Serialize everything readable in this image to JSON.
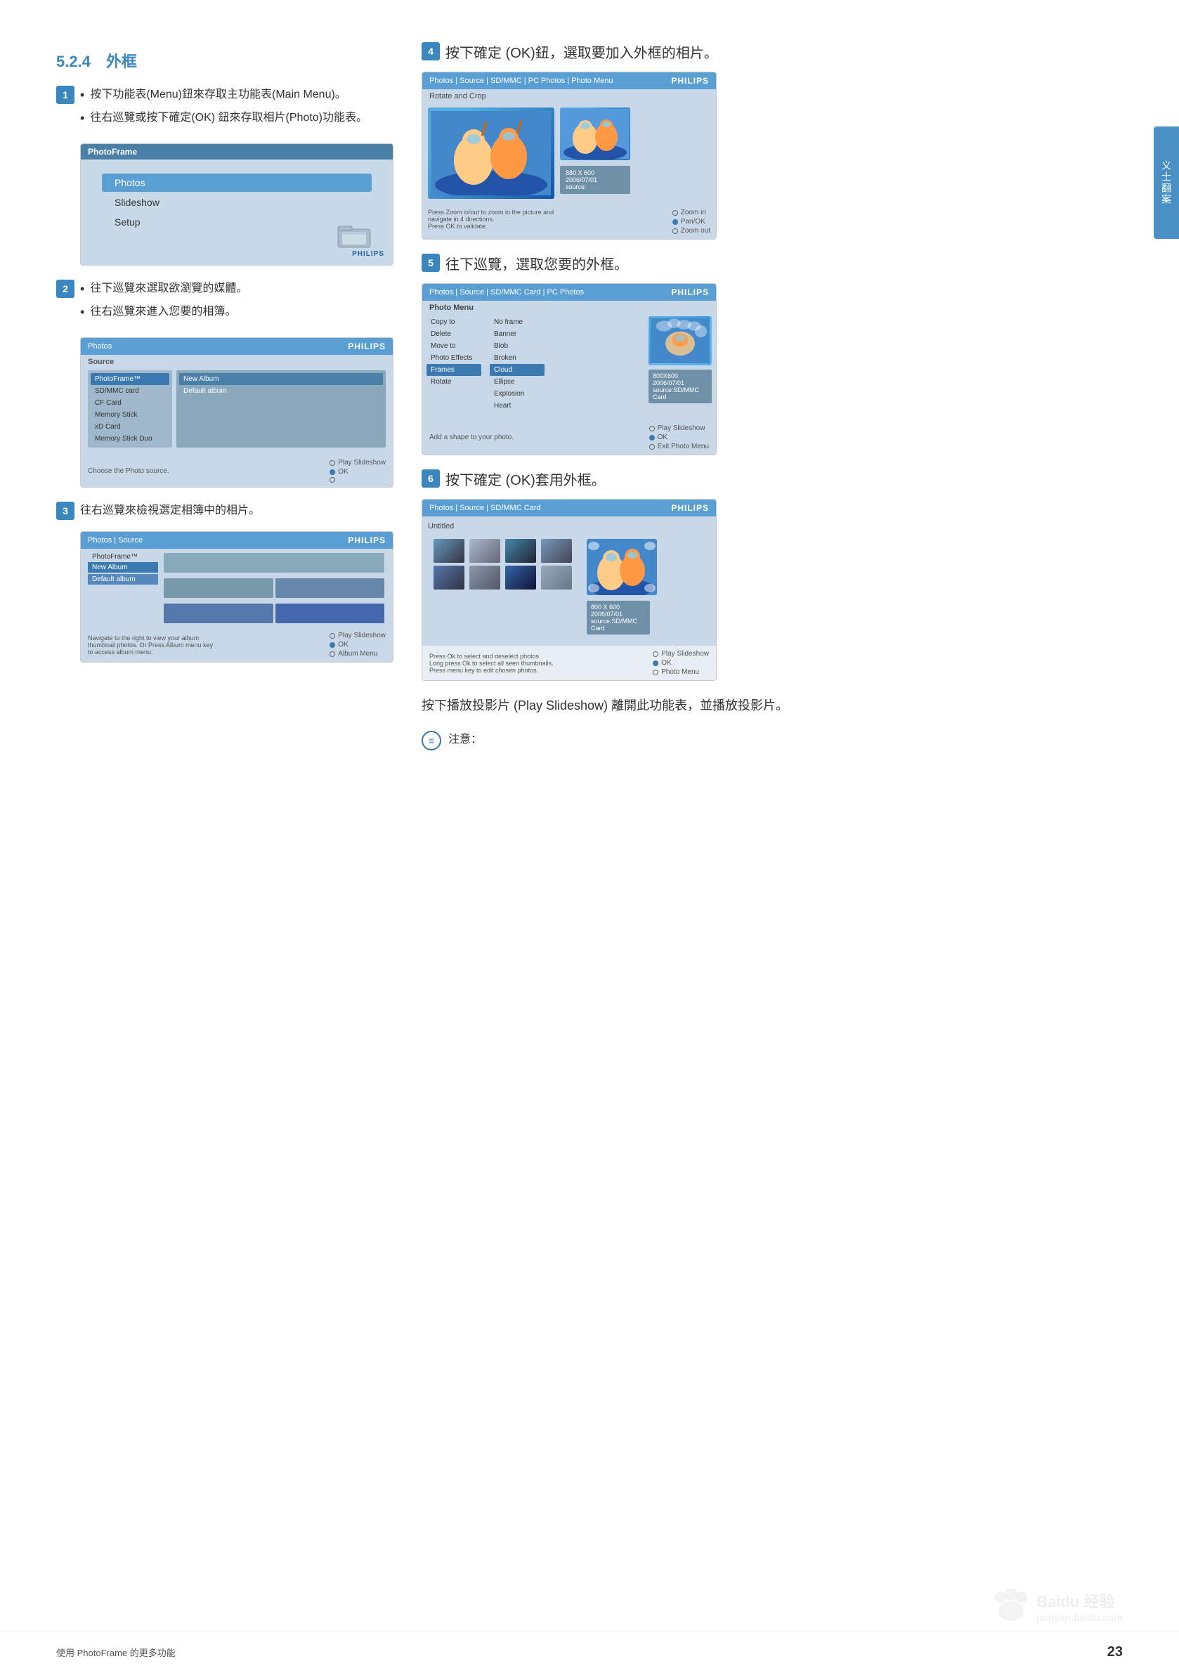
{
  "page": {
    "title": "使用 PhotoFrame 的更多功能",
    "page_number": "23",
    "section": "5.2.4　外框",
    "sidebar_tab": "义士翻案"
  },
  "steps": {
    "step1": {
      "badge": "1",
      "bullets": [
        "按下功能表(Menu)鈕來存取主功能表(Main Menu)。",
        "往右巡覽或按下確定(OK) 鈕來存取相片(Photo)功能表。"
      ]
    },
    "step2": {
      "badge": "2",
      "bullets": [
        "往下巡覽來選取欲瀏覽的媒體。",
        "往右巡覽來進入您要的相簿。"
      ]
    },
    "step3": {
      "badge": "3",
      "text": "往右巡覽來檢視選定相簿中的相片。"
    },
    "step4": {
      "badge": "4",
      "text": "按下確定 (OK)鈕，選取要加入外框的相片。"
    },
    "step5": {
      "badge": "5",
      "text": "往下巡覽，選取您要的外框。"
    },
    "step6": {
      "badge": "6",
      "text": "按下確定 (OK)套用外框。"
    }
  },
  "note": {
    "icon": "≡",
    "text": "注意："
  },
  "slideshow_text": "按下播放投影片 (Play Slideshow) 離開此功能表，並播放投影片。",
  "screens": {
    "photoframe_menu": {
      "title": "PhotoFrame",
      "items": [
        "Photos",
        "Slideshow",
        "Setup"
      ],
      "active_item": "Photos",
      "philips": "PHILIPS"
    },
    "source_screen": {
      "header_path": "Photos",
      "philips": "PHILIPS",
      "source_label": "Source",
      "items": [
        "PhotoFrame™",
        "SD/MMC card",
        "CF Card",
        "Memory Stick",
        "xD Card",
        "Memory Stick Duo"
      ],
      "active_item": "PhotoFrame™",
      "albums": [
        "New Album",
        "Default album"
      ],
      "footer_text": "Choose the Photo source.",
      "options": [
        "Play Slideshow",
        "OK"
      ]
    },
    "album_screen": {
      "header_path": "Photos | Source",
      "philips": "PHILIPS",
      "items": [
        "PhotoFrame™",
        "New Album",
        "Default album"
      ],
      "footer_text": "Navigate to the right to view your album thumbnail photos. Or Press Album menu key to access album menu.",
      "options": [
        "Play Slideshow",
        "OK",
        "Album Menu"
      ]
    },
    "rotate_crop_screen": {
      "header_path": "Photos | Source | SD/MMC | PC Photos | Photo Menu",
      "philips": "PHILIPS",
      "title": "Rotate and Crop",
      "info": "880 X 600\n2006/07/01\nsource:",
      "footer_text": "Press Zoom in/out to zoom in the picture and navigate in 4 directions.\nPress OK to validate.",
      "options": [
        "Zoom in",
        "Pan/OK",
        "Zoom out"
      ]
    },
    "photo_menu_screen": {
      "header_path": "Photos | Source | SD/MMC Card | PC Photos",
      "philips": "PHILIPS",
      "menu_label": "Photo Menu",
      "left_items": [
        "Copy to",
        "Delete",
        "Move to",
        "Photo Effects",
        "Frames",
        "Rotate"
      ],
      "active_left": "Frames",
      "center_items": [
        "No frame",
        "Banner",
        "Blob",
        "Broken",
        "Cloud",
        "Ellipse",
        "Explosion",
        "Heart"
      ],
      "active_center": "Cloud",
      "info": "800X600\n2006/07/01\nsource:SD/MMC Card",
      "footer_text": "Add a shape to your photo.",
      "options": [
        "Play Slideshow",
        "OK",
        "Exit Photo Menu"
      ]
    },
    "photo_grid_screen": {
      "header_path": "Photos | Source | SD/MMC Card",
      "philips": "PHILIPS",
      "title": "Untitled",
      "info": "800 X 600\n2006/07/01\nsource:SD/MMC Card",
      "footer_text": "Press Ok to select and deselect photos\nLong press Ok to select all seen thumbnails.\nPress menu key to edit chosen photos.",
      "options": [
        "Play Slideshow",
        "OK",
        "Photo Menu"
      ]
    }
  },
  "bottom": {
    "left_text": "使用 PhotoFrame 的更多功能",
    "page_number": "23",
    "baidu_text": "Baidu 经验\njingyan.baidu.com"
  }
}
